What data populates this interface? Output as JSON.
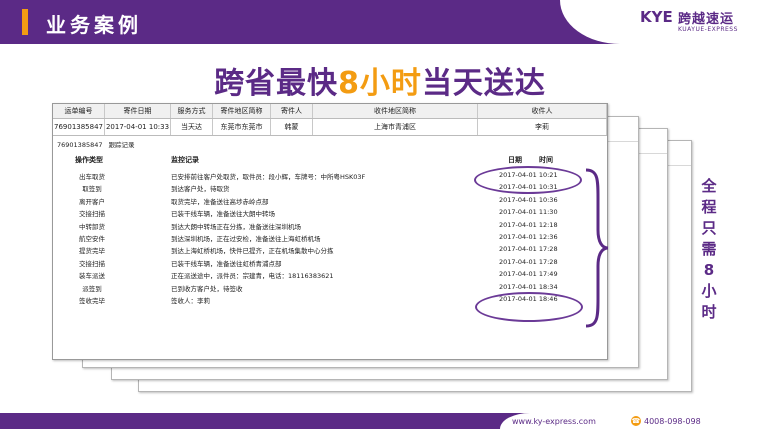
{
  "header": {
    "section_title": "业务案例",
    "logo_mark": "KYE",
    "logo_name": "跨越速运",
    "logo_en": "KUAYUE-EXPRESS"
  },
  "headline": {
    "pre": "跨省最快",
    "highlight": "8小时",
    "post": "当天送达"
  },
  "table": {
    "headers": [
      "运单编号",
      "寄件日期",
      "服务方式",
      "寄件地区简称",
      "寄件人",
      "收件地区简称",
      "收件人"
    ],
    "shipment": [
      "76901385847",
      "2017-04-01 10:33",
      "当天达",
      "东莞市东莞市",
      "韩蒙",
      "上海市青浦区",
      "李莉"
    ],
    "tab_waybill": "76901385847",
    "tab_label": "跟踪记录",
    "col_op": "操作类型",
    "col_record": "监控记录",
    "col_date": "日期",
    "col_time": "时间",
    "rows": [
      {
        "op": "出车取货",
        "record": "已安排前往客户处取货，取件员：段小辉，车牌号：中所粤HSK03F",
        "time": "2017-04-01 10:21"
      },
      {
        "op": "取签到",
        "record": "到达客户处，待取货",
        "time": "2017-04-01 10:31"
      },
      {
        "op": "离开客户",
        "record": "取货完毕，准备送往高埗赤岭点部",
        "time": "2017-04-01 10:36"
      },
      {
        "op": "交接扫描",
        "record": "已装干线车辆，准备送往大朗中转场",
        "time": "2017-04-01 11:30"
      },
      {
        "op": "中转卸货",
        "record": "到达大朗中转场正在分拣，准备送往深圳机场",
        "time": "2017-04-01 12:18"
      },
      {
        "op": "航空安件",
        "record": "到达深圳机场，正在过安检，准备送往上海虹桥机场",
        "time": "2017-04-01 12:36"
      },
      {
        "op": "提货完毕",
        "record": "到达上海虹桥机场，快件已提齐，正在机场集散中心分拣",
        "time": "2017-04-01 17:28"
      },
      {
        "op": "交接扫描",
        "record": "已装干线车辆，准备送往虹桥青浦点部",
        "time": "2017-04-01 17:28"
      },
      {
        "op": "装车派送",
        "record": "正在派送途中，派件员：宗建青，电话：18116383621",
        "time": "2017-04-01 17:49"
      },
      {
        "op": "派签到",
        "record": "已到收方客户处，待签收",
        "time": "2017-04-01 18:34"
      },
      {
        "op": "签收完毕",
        "record": "签收人：李莉",
        "time": "2017-04-01 18:46"
      }
    ]
  },
  "side_text": [
    "全",
    "程",
    "只",
    "需",
    "8",
    "小",
    "时"
  ],
  "footer": {
    "url": "www.ky-express.com",
    "phone": "4008-098-098"
  },
  "colors": {
    "brand_purple": "#5b2a86",
    "accent_orange": "#f39c12"
  }
}
